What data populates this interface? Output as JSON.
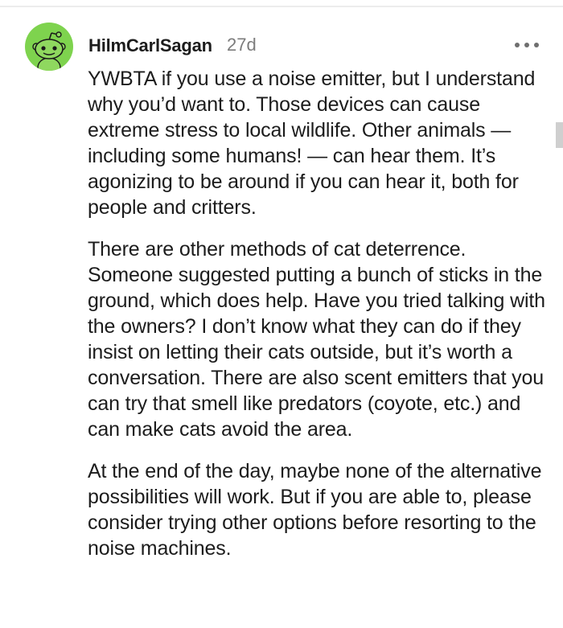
{
  "comment": {
    "author": "HilmCarlSagan",
    "age": "27d",
    "avatar_icon": "reddit-snoo-avatar-icon",
    "avatar_color": "#7ed34e",
    "more_icon": "more-options-icon",
    "paragraphs": [
      "YWBTA if you use a noise emitter, but I understand why you’d want to. Those devices can cause extreme stress to local wildlife. Other animals — including some humans! — can hear them. It’s agonizing to be around if you can hear it, both for people and critters.",
      "There are other methods of cat deterrence. Someone suggested putting a bunch of sticks in the ground, which does help. Have you tried talking with the owners? I don’t know what they can do if they insist on letting their cats outside, but it’s worth a conversation. There are also scent emitters that you can try that smell like predators (coyote, etc.) and can make cats avoid the area.",
      "At the end of the day, maybe none of the alternative possibilities will work. But if you are able to, please consider trying other options before resorting to the noise machines."
    ]
  }
}
